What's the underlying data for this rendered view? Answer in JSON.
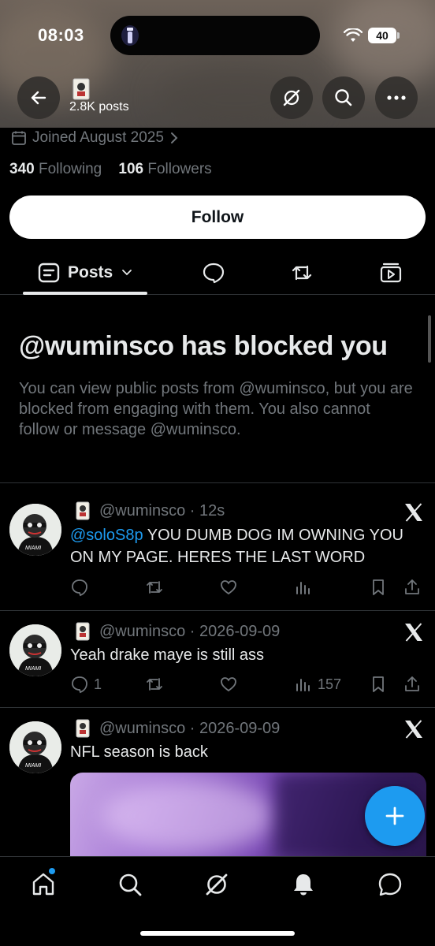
{
  "status_bar": {
    "time": "08:03",
    "battery": "40"
  },
  "header": {
    "posts_count": "2.8K posts"
  },
  "profile": {
    "joined": "Joined August 2025",
    "following_count": "340",
    "following_label": "Following",
    "followers_count": "106",
    "followers_label": "Followers",
    "follow_button": "Follow"
  },
  "tabs": {
    "posts_label": "Posts"
  },
  "blocked": {
    "title": "@wuminsco has blocked you",
    "description": "You can view public posts from @wuminsco, but you are blocked from engaging with them. You also cannot follow or message @wuminsco."
  },
  "tweets": [
    {
      "handle": "@wuminsco",
      "time": "12s",
      "mention": "@soloS8p",
      "text": " YOU DUMB DOG IM OWNING YOU ON MY PAGE. HERES THE LAST WORD",
      "replies": "",
      "views": ""
    },
    {
      "handle": "@wuminsco",
      "time": "2026-09-09",
      "mention": "",
      "text": "Yeah drake maye is still ass",
      "replies": "1",
      "views": "157"
    },
    {
      "handle": "@wuminsco",
      "time": "2026-09-09",
      "mention": "",
      "text": "NFL season is back",
      "replies": "",
      "views": ""
    }
  ],
  "colors": {
    "accent": "#1d9bf0",
    "muted": "#71767b",
    "text": "#e7e9ea",
    "background": "#000000"
  }
}
